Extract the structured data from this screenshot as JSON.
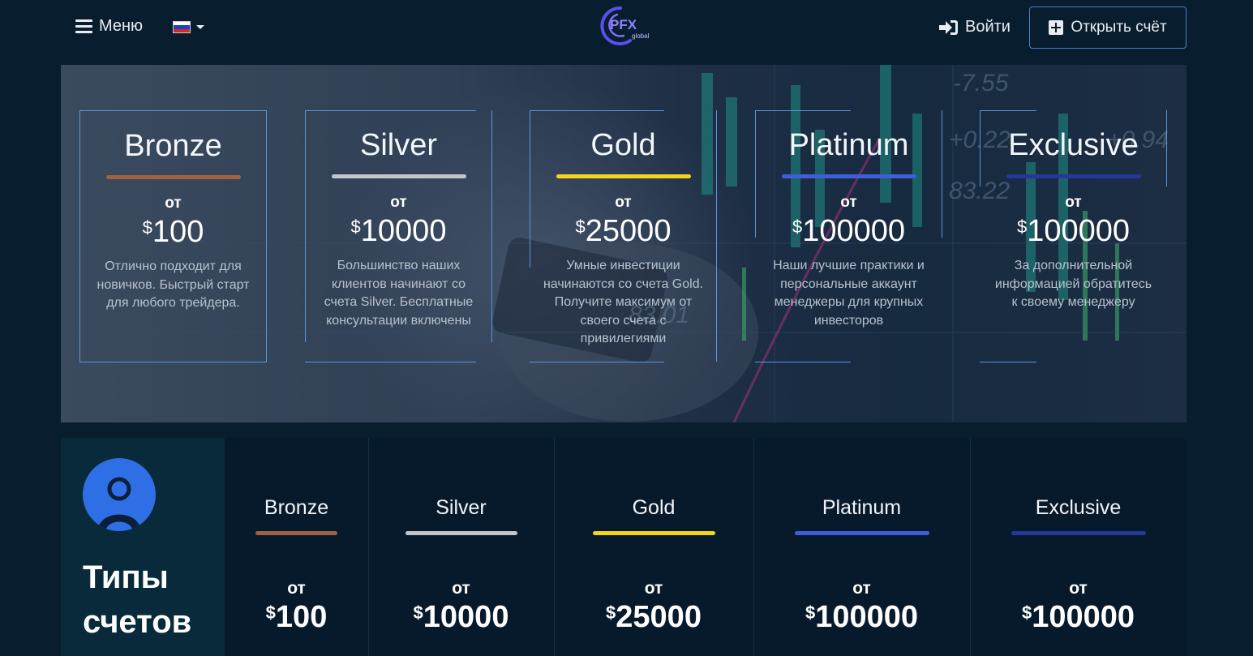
{
  "header": {
    "menu_label": "Меню",
    "language": "ru",
    "logo_text": "PFX",
    "logo_sub": "global",
    "login_label": "Войти",
    "open_account_label": "Открыть счёт"
  },
  "hero": {
    "bg_numbers": [
      "-7.55",
      "+0.22",
      "83.22",
      "+0.94",
      "83.01"
    ],
    "plans": [
      {
        "name": "Bronze",
        "from": "от",
        "currency": "$",
        "price": "100",
        "color": "#a0633e",
        "desc": "Отлично подходит для новичков. Быстрый старт для любого трейдера."
      },
      {
        "name": "Silver",
        "from": "от",
        "currency": "$",
        "price": "10000",
        "color": "#c3c6ca",
        "desc": "Большинство наших клиентов начинают со счета Silver. Бесплатные консультации включены"
      },
      {
        "name": "Gold",
        "from": "от",
        "currency": "$",
        "price": "25000",
        "color": "#f5d419",
        "desc": "Умные инвестиции начинаются со счета Gold. Получите максимум от своего счета с привилегиями"
      },
      {
        "name": "Platinum",
        "from": "от",
        "currency": "$",
        "price": "100000",
        "color": "#3f5fd9",
        "desc": "Наши лучшие практики и персональные аккаунт менеджеры для крупных инвесторов"
      },
      {
        "name": "Exclusive",
        "from": "от",
        "currency": "$",
        "price": "100000",
        "color": "#263799",
        "desc": "За дополнительной информацией обратитесь к своему менеджеру"
      }
    ]
  },
  "types": {
    "title": "Типы счетов",
    "columns": [
      {
        "name": "Bronze",
        "from": "от",
        "currency": "$",
        "price": "100",
        "color": "#a0633e"
      },
      {
        "name": "Silver",
        "from": "от",
        "currency": "$",
        "price": "10000",
        "color": "#c3c6ca"
      },
      {
        "name": "Gold",
        "from": "от",
        "currency": "$",
        "price": "25000",
        "color": "#f5d419"
      },
      {
        "name": "Platinum",
        "from": "от",
        "currency": "$",
        "price": "100000",
        "color": "#3f5fd9"
      },
      {
        "name": "Exclusive",
        "from": "от",
        "currency": "$",
        "price": "100000",
        "color": "#263799"
      }
    ]
  }
}
